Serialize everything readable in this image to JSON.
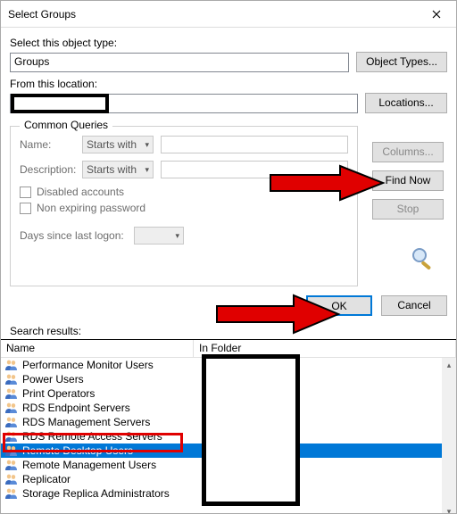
{
  "titlebar": {
    "title": "Select Groups"
  },
  "object_type": {
    "label": "Select this object type:",
    "value": "Groups",
    "button": "Object Types..."
  },
  "location": {
    "label": "From this location:",
    "button": "Locations..."
  },
  "fieldset": {
    "legend": "Common Queries",
    "name_label": "Name:",
    "name_combo": "Starts with",
    "desc_label": "Description:",
    "desc_combo": "Starts with",
    "disabled_chk": "Disabled accounts",
    "nonexp_chk": "Non expiring password",
    "days_label": "Days since last logon:"
  },
  "sidebtns": {
    "columns": "Columns...",
    "findnow": "Find Now",
    "stop": "Stop"
  },
  "okcancel": {
    "ok": "OK",
    "cancel": "Cancel"
  },
  "results": {
    "label": "Search results:",
    "col_name": "Name",
    "col_folder": "In Folder",
    "items": [
      "Performance Monitor Users",
      "Power Users",
      "Print Operators",
      "RDS Endpoint Servers",
      "RDS Management Servers",
      "RDS Remote Access Servers",
      "Remote Desktop Users",
      "Remote Management Users",
      "Replicator",
      "Storage Replica Administrators"
    ],
    "selected_index": 6
  }
}
